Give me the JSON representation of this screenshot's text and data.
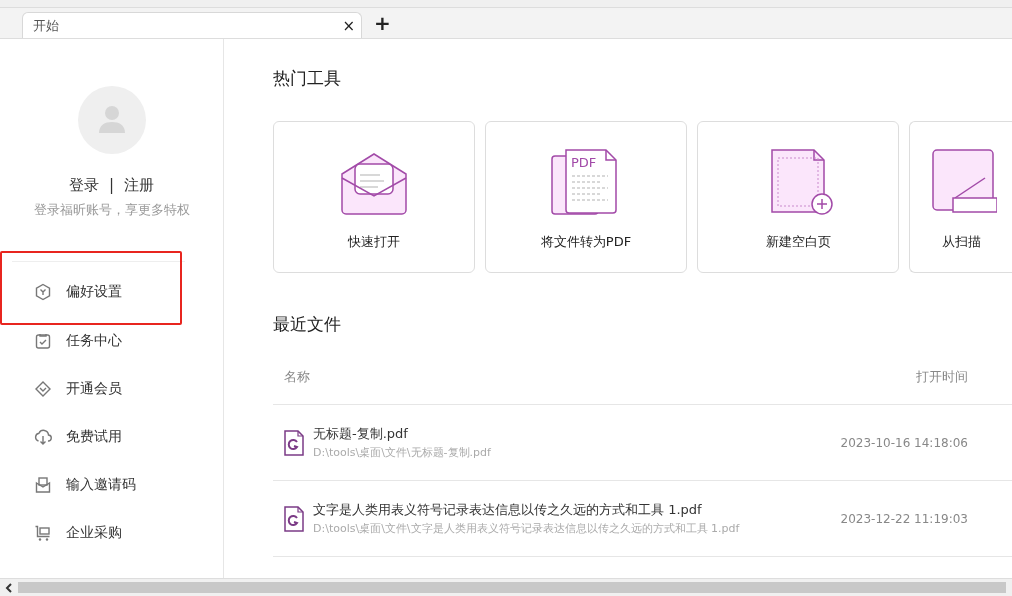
{
  "tabs": [
    {
      "label": "开始",
      "selected": true,
      "close": "×"
    }
  ],
  "new_tab": "+",
  "account": {
    "login": "登录",
    "separator": "|",
    "register": "注册",
    "hint": "登录福昕账号，享更多特权"
  },
  "sidebar": {
    "items": [
      {
        "label": "偏好设置",
        "kind": "settings",
        "highlighted": true
      },
      {
        "label": "任务中心",
        "kind": "task",
        "highlighted": false
      },
      {
        "label": "开通会员",
        "kind": "vip",
        "highlighted": false
      },
      {
        "label": "免费试用",
        "kind": "download",
        "highlighted": false
      },
      {
        "label": "输入邀请码",
        "kind": "invite",
        "highlighted": false
      },
      {
        "label": "企业采购",
        "kind": "cart",
        "highlighted": false
      }
    ]
  },
  "hot_tools": {
    "title": "热门工具",
    "tools": [
      {
        "label": "快速打开",
        "kind": "open"
      },
      {
        "label": "将文件转为PDF",
        "kind": "convert",
        "badge": "PDF"
      },
      {
        "label": "新建空白页",
        "kind": "blank"
      },
      {
        "label": "从扫描",
        "kind": "scan"
      }
    ]
  },
  "recent": {
    "title": "最近文件",
    "columns": [
      "名称",
      "打开时间"
    ],
    "rows": [
      {
        "name": "无标题-复制.pdf",
        "path": "D:\\tools\\桌面\\文件\\无标题-复制.pdf",
        "opened": "2023-10-16 14:18:06"
      },
      {
        "name": "文字是人类用表义符号记录表达信息以传之久远的方式和工具 1.pdf",
        "path": "D:\\tools\\桌面\\文件\\文字是人类用表义符号记录表达信息以传之久远的方式和工具 1.pdf",
        "opened": "2023-12-22 11:19:03"
      }
    ]
  }
}
